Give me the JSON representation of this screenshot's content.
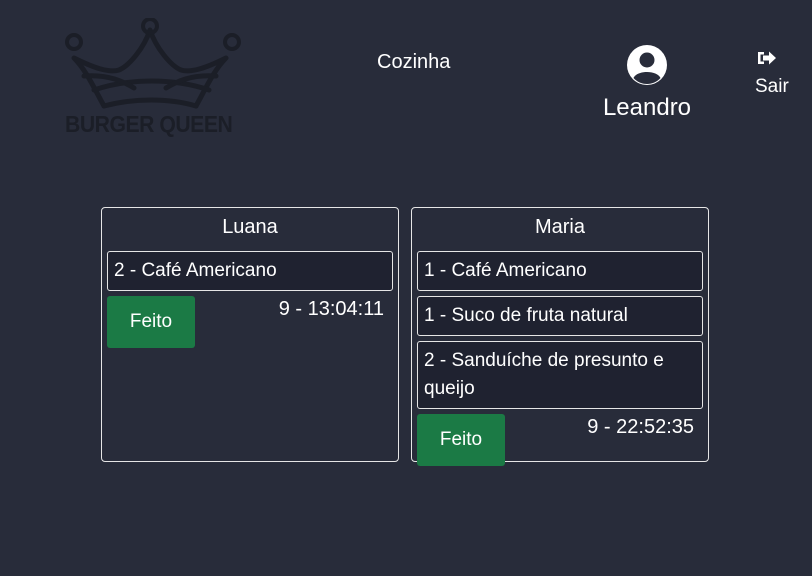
{
  "header": {
    "logo_text": "BURGER QUEEN",
    "section_title": "Cozinha",
    "user_name": "Leandro",
    "logout_label": "Sair",
    "avatar_icon": "user-circle-icon",
    "logout_icon": "sign-out-icon"
  },
  "colors": {
    "background": "#282c3a",
    "done_button": "#1b7a45",
    "card_border": "#e6e6e6",
    "item_background": "#1f2230"
  },
  "orders": [
    {
      "client": "Luana",
      "items": [
        "2 - Café Americano"
      ],
      "done_label": "Feito",
      "time": "9 - 13:04:11"
    },
    {
      "client": "Maria",
      "items": [
        "1 - Café Americano",
        "1 - Suco de fruta natural",
        "2 - Sanduíche de presunto e queijo"
      ],
      "done_label": "Feito",
      "time": "9 - 22:52:35"
    }
  ]
}
